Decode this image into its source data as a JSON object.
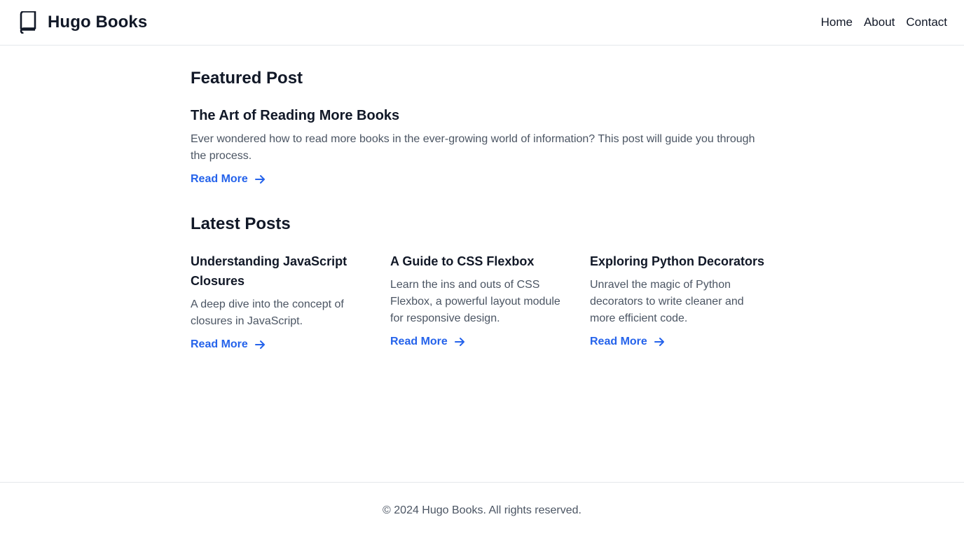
{
  "header": {
    "brand": "Hugo Books",
    "brand_icon": "book-icon",
    "nav": [
      "Home",
      "About",
      "Contact"
    ]
  },
  "featured": {
    "section_title": "Featured Post",
    "title": "The Art of Reading More Books",
    "excerpt": "Ever wondered how to read more books in the ever-growing world of information? This post will guide you through the process.",
    "link": "Read More"
  },
  "latest": {
    "section_title": "Latest Posts",
    "posts": [
      {
        "title": "Understanding JavaScript Closures",
        "excerpt": "A deep dive into the concept of closures in JavaScript.",
        "link": "Read More"
      },
      {
        "title": "A Guide to CSS Flexbox",
        "excerpt": "Learn the ins and outs of CSS Flexbox, a powerful layout module for responsive design.",
        "link": "Read More"
      },
      {
        "title": "Exploring Python Decorators",
        "excerpt": "Unravel the magic of Python decorators to write cleaner and more efficient code.",
        "link": "Read More"
      }
    ]
  },
  "footer": {
    "copyright": "© 2024 Hugo Books. All rights reserved."
  },
  "colors": {
    "accent": "#2563eb",
    "text": "#111827",
    "muted": "#4b5563",
    "border": "#e5e7eb"
  }
}
